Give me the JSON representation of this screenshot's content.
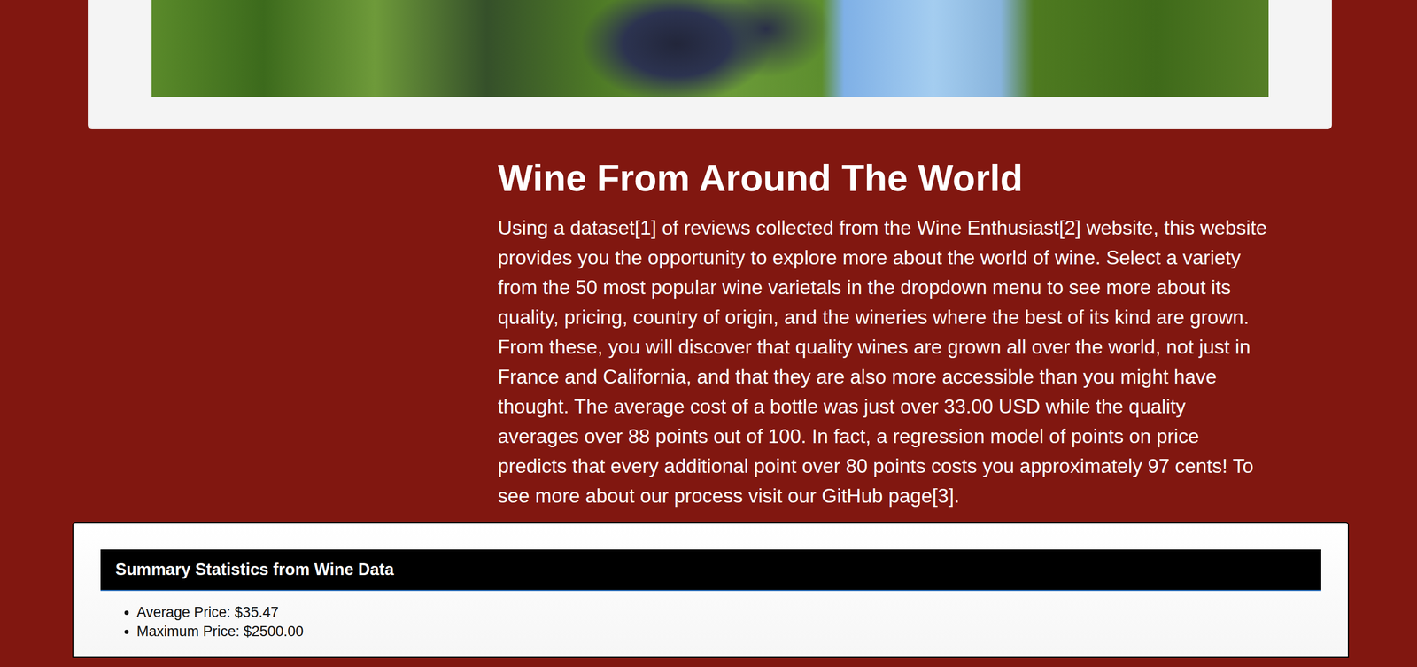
{
  "intro": {
    "title": "Wine From Around The World",
    "body": "Using a dataset[1] of reviews collected from the Wine Enthusiast[2] website, this website provides you the opportunity to explore more about the world of wine. Select a variety from the 50 most popular wine varietals in the dropdown menu to see more about its quality, pricing, country of origin, and the wineries where the best of its kind are grown. From these, you will discover that quality wines are grown all over the world, not just in France and California, and that they are also more accessible than you might have thought. The average cost of a bottle was just over 33.00 USD while the quality averages over 88 points out of 100. In fact, a regression model of points on price predicts that every additional point over 80 points costs you approximately 97 cents! To see more about our process visit our GitHub page[3]."
  },
  "summary": {
    "title": "Summary Statistics from Wine Data",
    "items": [
      "Average Price: $35.47",
      "Maximum Price: $2500.00"
    ]
  }
}
